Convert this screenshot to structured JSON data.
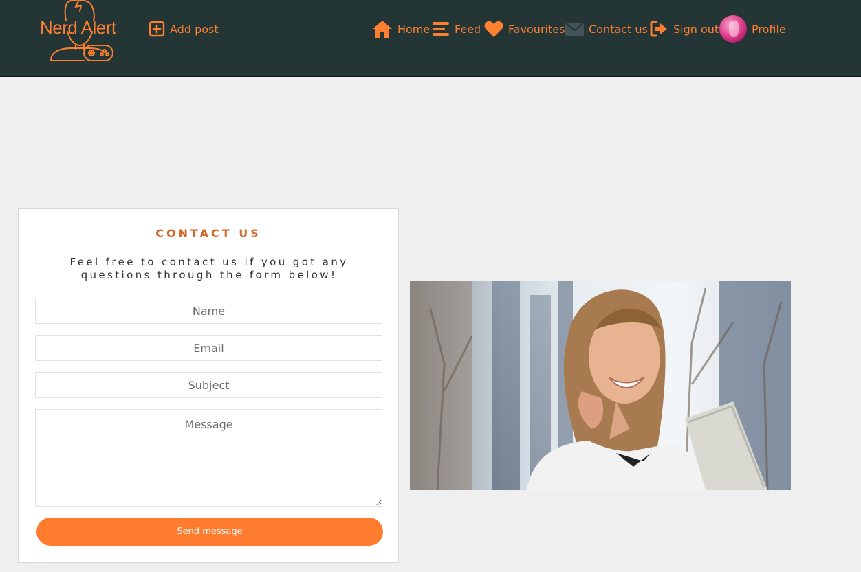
{
  "brand": {
    "name": "Nerd Alert"
  },
  "nav": {
    "add_post": "Add post",
    "home": "Home",
    "feed": "Feed",
    "favourites": "Favourites",
    "contact_us": "Contact us",
    "sign_out": "Sign out",
    "profile": "Profile"
  },
  "contact": {
    "title": "CONTACT US",
    "description": "Feel free to contact us if you got any questions through the form below!",
    "fields": {
      "name_placeholder": "Name",
      "email_placeholder": "Email",
      "subject_placeholder": "Subject",
      "message_placeholder": "Message"
    },
    "submit_label": "Send message"
  },
  "colors": {
    "accent": "#ff7f30",
    "navbar": "#243535",
    "background": "#efefef"
  },
  "icons": {
    "add": "plus-square-icon",
    "home": "house-icon",
    "feed": "bars-icon",
    "favourites": "heart-icon",
    "contact": "envelope-icon",
    "sign_out": "sign-out-icon"
  }
}
